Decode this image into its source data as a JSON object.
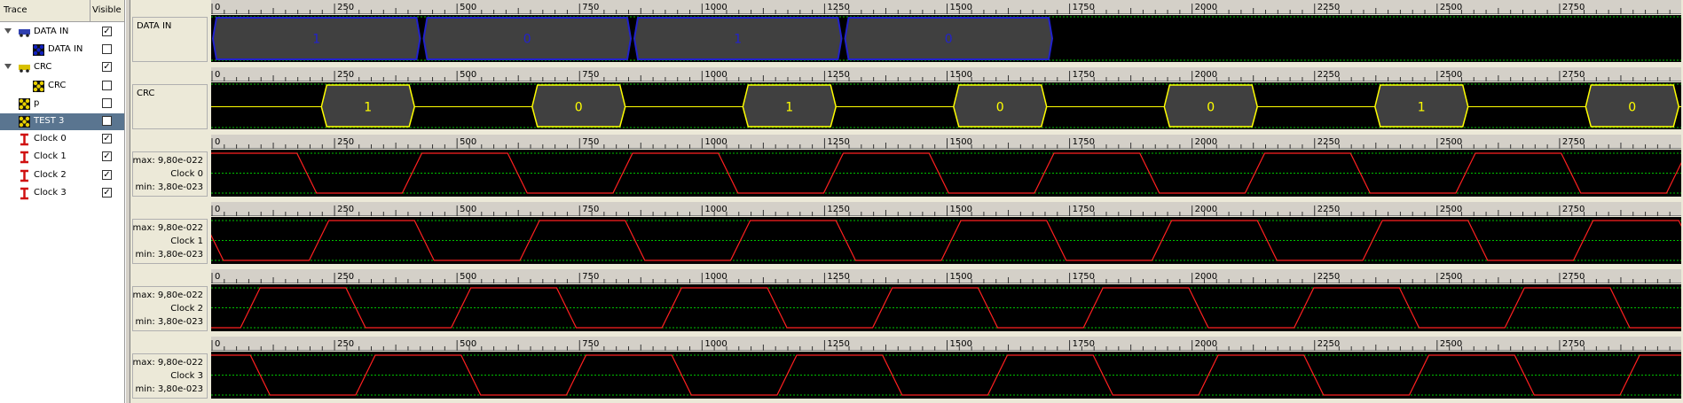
{
  "columns": {
    "trace": "Trace",
    "visible": "Visible"
  },
  "tree": [
    {
      "label": "DATA IN",
      "indent": 0,
      "expander": true,
      "icon": "bus-icon",
      "checked": true,
      "selected": false
    },
    {
      "label": "DATA IN",
      "indent": 1,
      "expander": false,
      "icon": "signal-icon-blue",
      "checked": false,
      "selected": false
    },
    {
      "label": "CRC",
      "indent": 0,
      "expander": true,
      "icon": "bus-icon-yellow",
      "checked": true,
      "selected": false
    },
    {
      "label": "CRC",
      "indent": 1,
      "expander": false,
      "icon": "signal-icon-yellow",
      "checked": false,
      "selected": false
    },
    {
      "label": "p",
      "indent": 0,
      "expander": false,
      "icon": "signal-icon-yellow",
      "checked": false,
      "selected": false
    },
    {
      "label": "TEST 3",
      "indent": 0,
      "expander": false,
      "icon": "signal-icon-yellow",
      "checked": false,
      "selected": true
    },
    {
      "label": "Clock 0",
      "indent": 0,
      "expander": false,
      "icon": "clock-icon",
      "checked": true,
      "selected": false
    },
    {
      "label": "Clock 1",
      "indent": 0,
      "expander": false,
      "icon": "clock-icon",
      "checked": true,
      "selected": false
    },
    {
      "label": "Clock 2",
      "indent": 0,
      "expander": false,
      "icon": "clock-icon",
      "checked": true,
      "selected": false
    },
    {
      "label": "Clock 3",
      "indent": 0,
      "expander": false,
      "icon": "clock-icon",
      "checked": true,
      "selected": false
    }
  ],
  "ruler": {
    "ticks": [
      "0",
      "250",
      "500",
      "750",
      "1000",
      "1250",
      "1500",
      "1750",
      "2000",
      "2250",
      "2500",
      "2750"
    ],
    "max": 3000
  },
  "lanes": [
    {
      "type": "bus",
      "name": "DATA IN",
      "color": "#2222cc",
      "values": [
        "1",
        "0",
        "1",
        "0"
      ],
      "segment_width": 430
    },
    {
      "type": "bus",
      "name": "CRC",
      "color": "#ffff00",
      "segments": [
        {
          "start": 225,
          "end": 415,
          "value": "1"
        },
        {
          "start": 655,
          "end": 845,
          "value": "0"
        },
        {
          "start": 1085,
          "end": 1275,
          "value": "1"
        },
        {
          "start": 1515,
          "end": 1705,
          "value": "0"
        },
        {
          "start": 1945,
          "end": 2135,
          "value": "0"
        },
        {
          "start": 2375,
          "end": 2565,
          "value": "1"
        },
        {
          "start": 2805,
          "end": 2995,
          "value": "0"
        }
      ]
    },
    {
      "type": "analog",
      "name": "Clock 0",
      "max": "max: 9,80e-022",
      "min": "min: 3,80e-023",
      "period": 430,
      "phase": 0
    },
    {
      "type": "analog",
      "name": "Clock 1",
      "max": "max: 9,80e-022",
      "min": "min: 3,80e-023",
      "period": 430,
      "phase": -190
    },
    {
      "type": "analog",
      "name": "Clock 2",
      "max": "max: 9,80e-022",
      "min": "min: 3,80e-023",
      "period": 430,
      "phase": 100
    },
    {
      "type": "analog",
      "name": "Clock 3",
      "max": "max: 9,80e-022",
      "min": "min: 3,80e-023",
      "period": 430,
      "phase": -95
    }
  ],
  "colors": {
    "analog_line": "#ff2020",
    "analog_top": "#ff8000",
    "grid_dots": "#00c000",
    "bus_fill": "#404040",
    "flat_line": "#ffff00"
  }
}
